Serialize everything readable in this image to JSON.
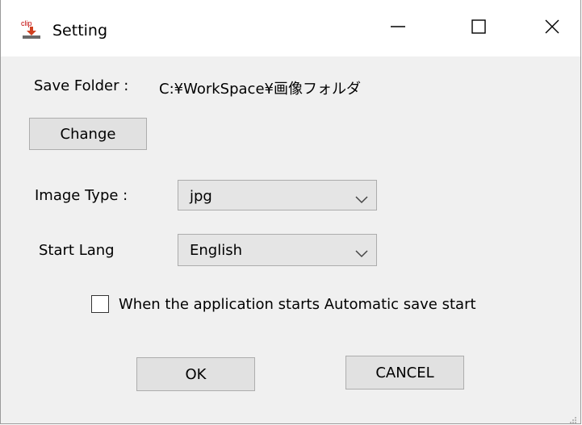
{
  "window": {
    "title": "Setting",
    "app_icon_text": "clip"
  },
  "save_folder": {
    "label": "Save Folder :",
    "path": "C:¥WorkSpace¥画像フォルダ"
  },
  "change_button": "Change",
  "image_type": {
    "label": "Image Type :",
    "value": "jpg"
  },
  "start_lang": {
    "label": "Start Lang",
    "value": "English"
  },
  "auto_save": {
    "label": "When the application starts Automatic save start",
    "checked": false
  },
  "ok_button": "OK",
  "cancel_button": "CANCEL",
  "icons": {
    "minimize": "minimize-icon",
    "maximize": "maximize-icon",
    "close": "close-icon",
    "dropdown": "chevron-down-icon"
  }
}
